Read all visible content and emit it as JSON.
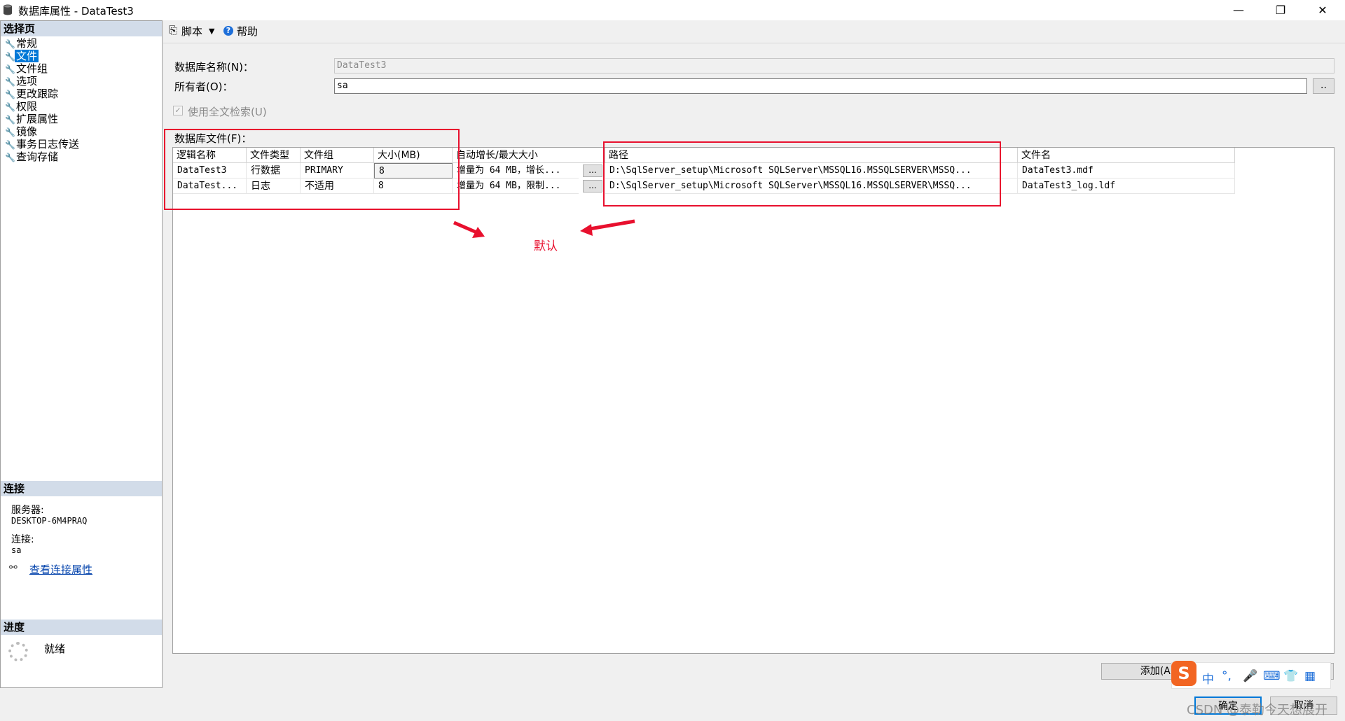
{
  "window": {
    "title": "数据库属性 - DataTest3",
    "controls": {
      "minimize": "—",
      "maximize": "❐",
      "close": "✕"
    }
  },
  "sidebar": {
    "select_page_header": "选择页",
    "pages": [
      {
        "label": "常规"
      },
      {
        "label": "文件",
        "selected": true
      },
      {
        "label": "文件组"
      },
      {
        "label": "选项"
      },
      {
        "label": "更改跟踪"
      },
      {
        "label": "权限"
      },
      {
        "label": "扩展属性"
      },
      {
        "label": "镜像"
      },
      {
        "label": "事务日志传送"
      },
      {
        "label": "查询存储"
      }
    ],
    "connection_header": "连接",
    "server_label": "服务器:",
    "server_value": "DESKTOP-6M4PRAQ",
    "connection_label": "连接:",
    "connection_value": "sa",
    "view_connection_link": "查看连接属性",
    "progress_header": "进度",
    "progress_status": "就绪"
  },
  "toolbar": {
    "script_label": "脚本",
    "help_label": "帮助"
  },
  "form": {
    "db_name_label": "数据库名称(N)：",
    "db_name_value": "DataTest3",
    "owner_label": "所有者(O)：",
    "owner_value": "sa",
    "owner_browse": "..",
    "fulltext_label": "使用全文检索(U)",
    "fulltext_checked": true,
    "db_files_label": "数据库文件(F)："
  },
  "grid": {
    "columns": [
      "逻辑名称",
      "文件类型",
      "文件组",
      "大小(MB)",
      "自动增长/最大大小",
      "路径",
      "文件名"
    ],
    "rows": [
      {
        "logical": "DataTest3",
        "type": "行数据",
        "group": "PRIMARY",
        "size": "8",
        "growth": "增量为 64 MB，增长...",
        "path": "D:\\SqlServer_setup\\Microsoft SQLServer\\MSSQL16.MSSQLSERVER\\MSSQ...",
        "filename": "DataTest3.mdf"
      },
      {
        "logical": "DataTest...",
        "type": "日志",
        "group": "不适用",
        "size": "8",
        "growth": "增量为 64 MB，限制...",
        "path": "D:\\SqlServer_setup\\Microsoft SQLServer\\MSSQL16.MSSQLSERVER\\MSSQ...",
        "filename": "DataTest3_log.ldf"
      }
    ],
    "ellipsis": "..."
  },
  "annotation": {
    "text": "默认",
    "color": "#e8102e"
  },
  "buttons": {
    "add": "添加(A)",
    "remove": "",
    "ok": "确定",
    "cancel": "取消"
  },
  "ime": {
    "logo": "S",
    "chinese": "中",
    "punct": "°,",
    "mic": "🎤",
    "keyboard": "⌨",
    "skin": "👕",
    "apps": "▦"
  },
  "watermark": "CSDN @泰勒今天想展开",
  "colors": {
    "selection": "#0078d7",
    "section_header": "#d2dce9",
    "link": "#0645ad",
    "ime_logo": "#f26522"
  }
}
